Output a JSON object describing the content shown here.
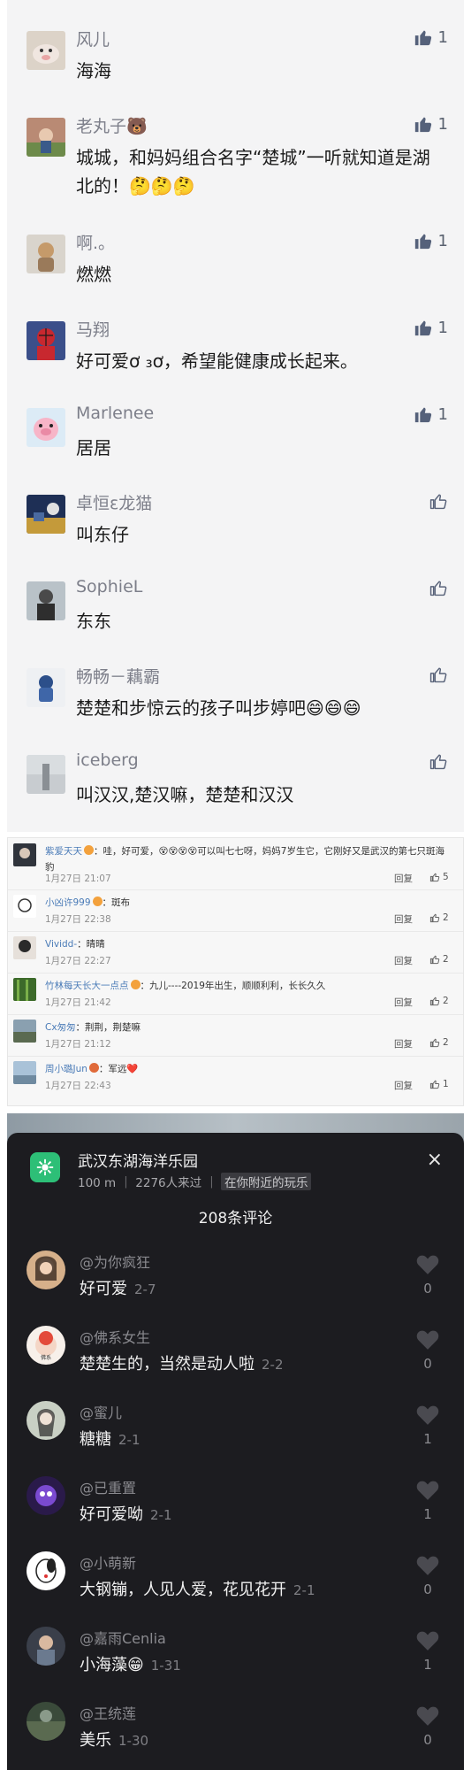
{
  "wechat": {
    "comments": [
      {
        "name": "风儿",
        "text": "海海",
        "likes": "1",
        "liked": true
      },
      {
        "name": "老丸子🐻",
        "text": "城城，和妈妈组合名字“楚城”一听就知道是湖北的！🤔🤔🤔",
        "likes": "1",
        "liked": true
      },
      {
        "name": "啊.。",
        "text": "燃燃",
        "likes": "1",
        "liked": true
      },
      {
        "name": "马翔",
        "text": "好可爱ơ ₃ơ，希望能健康成长起来。",
        "likes": "1",
        "liked": true
      },
      {
        "name": "Marlenee",
        "text": "居居",
        "likes": "1",
        "liked": true
      },
      {
        "name": "卓恒ε龙猫",
        "text": "叫东仔",
        "likes": "",
        "liked": false
      },
      {
        "name": "SophieL",
        "text": "东东",
        "likes": "",
        "liked": false
      },
      {
        "name": "畅畅－藕霸",
        "text": "楚楚和步惊云的孩子叫步婷吧😄😄😄",
        "likes": "",
        "liked": false
      },
      {
        "name": "iceberg",
        "text": "叫汉汉,楚汉嘛，楚楚和汉汉",
        "likes": "",
        "liked": false
      }
    ]
  },
  "weibo": {
    "reply_label": "回复",
    "comments": [
      {
        "user": "紫爱天天",
        "text": "：哇，好可爱，😵😵😵😵可以叫七七呀，妈妈7岁生它，它刚好又是武汉的第七只斑海豹",
        "time": "1月27日 21:07",
        "likes": "5"
      },
      {
        "user": "小凶许999",
        "text": "：斑布",
        "time": "1月27日 22:38",
        "likes": "2"
      },
      {
        "user": "Vividd-",
        "text": "：晴晴",
        "time": "1月27日 22:27",
        "likes": "2"
      },
      {
        "user": "竹林每天长大一点点",
        "text": "：九儿----2019年出生，顺顺利利，长长久久",
        "time": "1月27日 21:42",
        "likes": "2"
      },
      {
        "user": "Cx匆匆",
        "text": "：荆荆，荆楚嘛",
        "time": "1月27日 21:12",
        "likes": "2"
      },
      {
        "user": "周小璐Jun",
        "text": "：军远❤️",
        "time": "1月27日 22:43",
        "likes": "1"
      }
    ]
  },
  "douyin": {
    "location_title": "武汉东湖海洋乐园",
    "location_sub": "100 m ｜ 2276人来过 ｜",
    "location_tag": "在你附近的玩乐",
    "close_icon": "×",
    "comment_count": "208条评论",
    "comments": [
      {
        "name": "@为你疯狂",
        "text": "好可爱",
        "date": "2-7",
        "likes": "0"
      },
      {
        "name": "@佛系女生",
        "text": "楚楚生的，当然是动人啦",
        "date": "2-2",
        "likes": "0"
      },
      {
        "name": "@蜜儿",
        "text": "糖糖",
        "date": "2-1",
        "likes": "1"
      },
      {
        "name": "@已重置",
        "text": "好可爱呦",
        "date": "2-1",
        "likes": "1"
      },
      {
        "name": "@小萌新",
        "text": "大钢镚，人见人爱，花见花开",
        "date": "2-1",
        "likes": "0"
      },
      {
        "name": "@嘉雨Cenlia",
        "text": "小海藻😁",
        "date": "1-31",
        "likes": "1"
      },
      {
        "name": "@王统莲",
        "text": "美乐",
        "date": "1-30",
        "likes": "0"
      }
    ]
  },
  "colors": {
    "wechat_bg": "#f4f4f5",
    "weibo_link": "#4a7bb7",
    "douyin_panel": "#1c1c20",
    "douyin_icon": "#2dbf77"
  }
}
